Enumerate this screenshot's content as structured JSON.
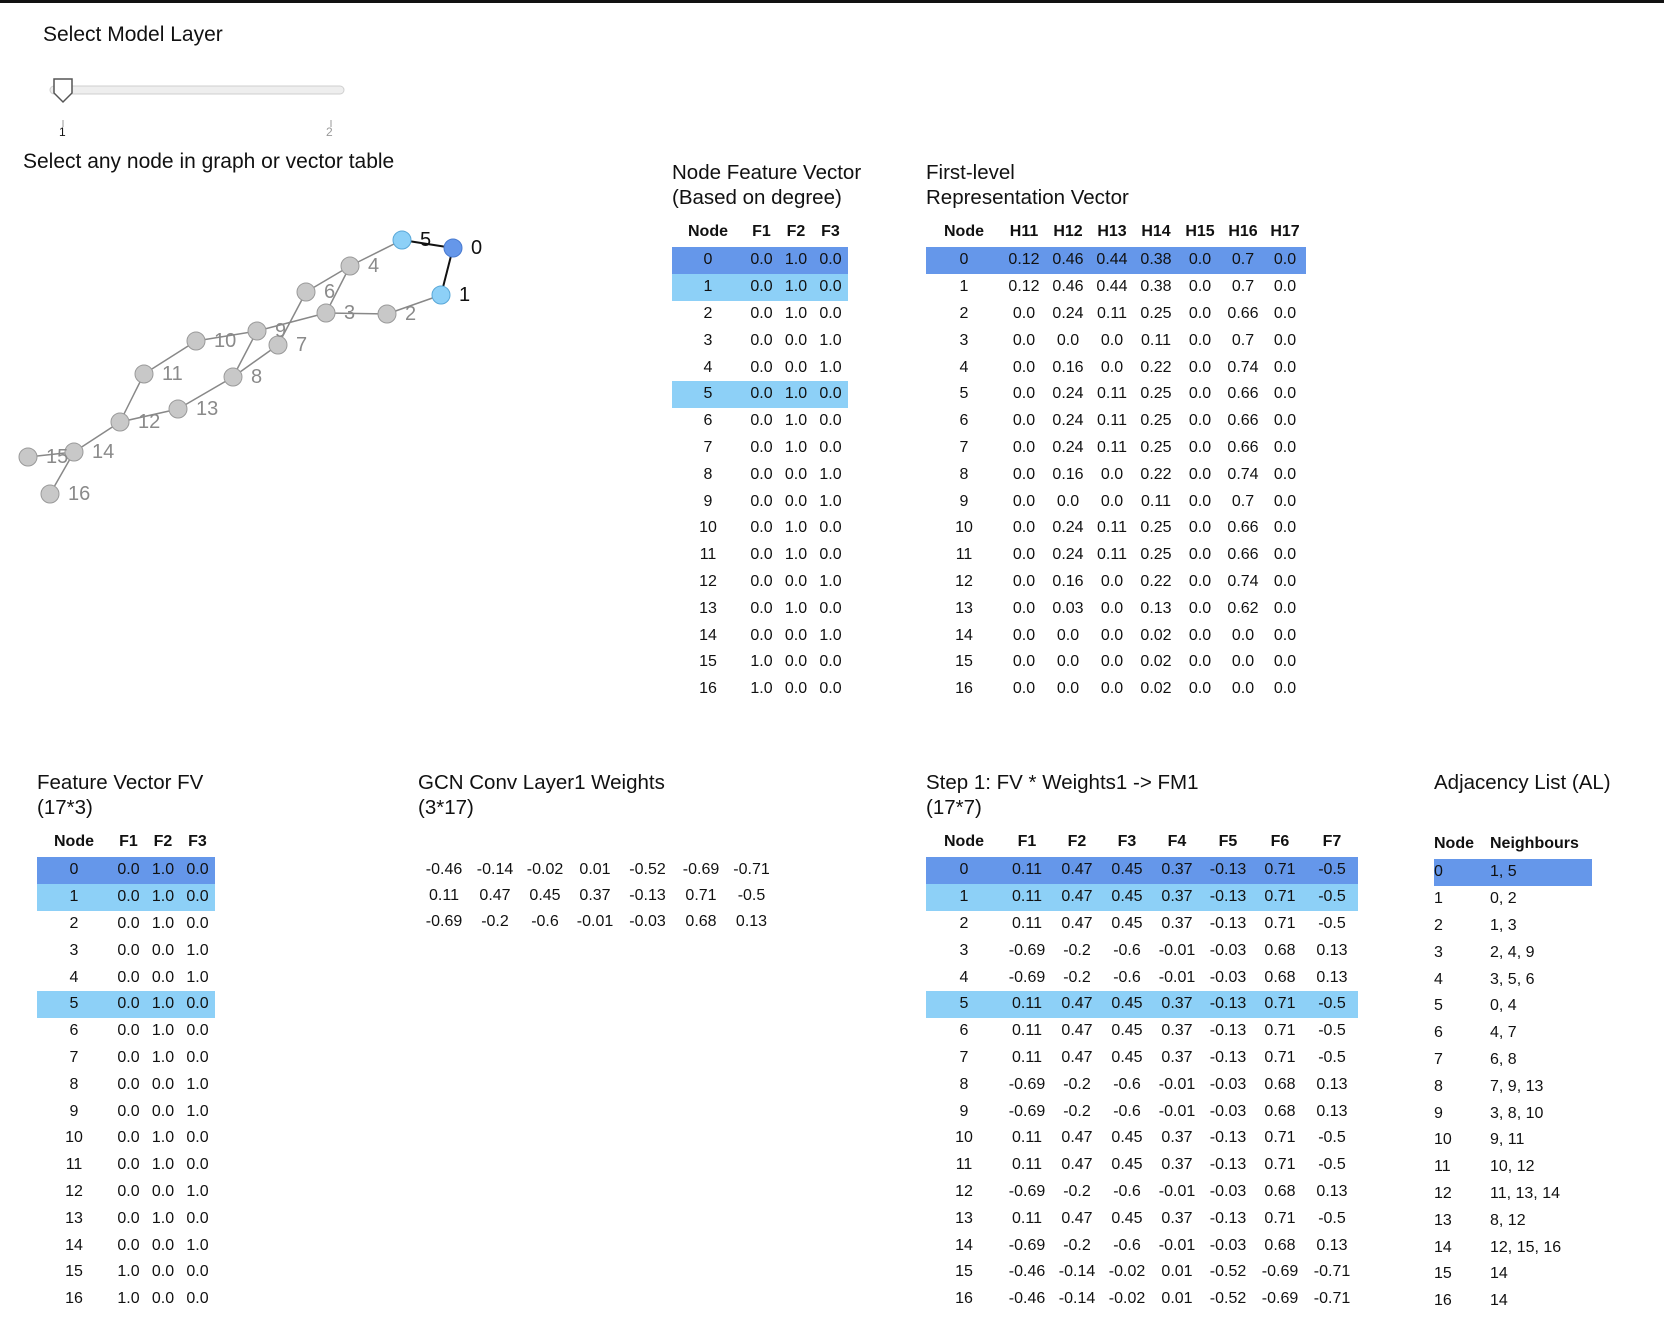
{
  "slider": {
    "label": "Select Model Layer",
    "min_label": "1",
    "max_label": "2",
    "value": 1,
    "min": 1,
    "max": 2
  },
  "instruction": "Select any node in graph or vector table",
  "selected_node": "0",
  "neighbour_nodes": [
    "1",
    "5"
  ],
  "colors": {
    "selected": "#6597ea",
    "neighbour": "#8dd0f7",
    "node_default": "#c8c8c8",
    "node_stroke": "#9a9a9a",
    "edge": "#888888"
  },
  "graph": {
    "nodes": [
      "0",
      "1",
      "2",
      "3",
      "4",
      "5",
      "6",
      "7",
      "8",
      "9",
      "10",
      "11",
      "12",
      "13",
      "14",
      "15",
      "16"
    ],
    "edges": [
      [
        "0",
        "1"
      ],
      [
        "0",
        "5"
      ],
      [
        "1",
        "2"
      ],
      [
        "2",
        "3"
      ],
      [
        "3",
        "4"
      ],
      [
        "3",
        "9"
      ],
      [
        "4",
        "5"
      ],
      [
        "4",
        "6"
      ],
      [
        "6",
        "7"
      ],
      [
        "7",
        "8"
      ],
      [
        "8",
        "9"
      ],
      [
        "8",
        "13"
      ],
      [
        "9",
        "10"
      ],
      [
        "10",
        "11"
      ],
      [
        "11",
        "12"
      ],
      [
        "12",
        "13"
      ],
      [
        "12",
        "14"
      ],
      [
        "14",
        "15"
      ],
      [
        "14",
        "16"
      ]
    ]
  },
  "node_feature": {
    "title_line1": "Node Feature Vector",
    "title_line2": "(Based on degree)",
    "headers": [
      "Node",
      "F1",
      "F2",
      "F3"
    ],
    "rows": [
      [
        "0",
        "0.0",
        "1.0",
        "0.0"
      ],
      [
        "1",
        "0.0",
        "1.0",
        "0.0"
      ],
      [
        "2",
        "0.0",
        "1.0",
        "0.0"
      ],
      [
        "3",
        "0.0",
        "0.0",
        "1.0"
      ],
      [
        "4",
        "0.0",
        "0.0",
        "1.0"
      ],
      [
        "5",
        "0.0",
        "1.0",
        "0.0"
      ],
      [
        "6",
        "0.0",
        "1.0",
        "0.0"
      ],
      [
        "7",
        "0.0",
        "1.0",
        "0.0"
      ],
      [
        "8",
        "0.0",
        "0.0",
        "1.0"
      ],
      [
        "9",
        "0.0",
        "0.0",
        "1.0"
      ],
      [
        "10",
        "0.0",
        "1.0",
        "0.0"
      ],
      [
        "11",
        "0.0",
        "1.0",
        "0.0"
      ],
      [
        "12",
        "0.0",
        "0.0",
        "1.0"
      ],
      [
        "13",
        "0.0",
        "1.0",
        "0.0"
      ],
      [
        "14",
        "0.0",
        "0.0",
        "1.0"
      ],
      [
        "15",
        "1.0",
        "0.0",
        "0.0"
      ],
      [
        "16",
        "1.0",
        "0.0",
        "0.0"
      ]
    ]
  },
  "first_level": {
    "title_line1": "First-level",
    "title_line2": "Representation Vector",
    "headers": [
      "Node",
      "H11",
      "H12",
      "H13",
      "H14",
      "H15",
      "H16",
      "H17"
    ],
    "rows": [
      [
        "0",
        "0.12",
        "0.46",
        "0.44",
        "0.38",
        "0.0",
        "0.7",
        "0.0"
      ],
      [
        "1",
        "0.12",
        "0.46",
        "0.44",
        "0.38",
        "0.0",
        "0.7",
        "0.0"
      ],
      [
        "2",
        "0.0",
        "0.24",
        "0.11",
        "0.25",
        "0.0",
        "0.66",
        "0.0"
      ],
      [
        "3",
        "0.0",
        "0.0",
        "0.0",
        "0.11",
        "0.0",
        "0.7",
        "0.0"
      ],
      [
        "4",
        "0.0",
        "0.16",
        "0.0",
        "0.22",
        "0.0",
        "0.74",
        "0.0"
      ],
      [
        "5",
        "0.0",
        "0.24",
        "0.11",
        "0.25",
        "0.0",
        "0.66",
        "0.0"
      ],
      [
        "6",
        "0.0",
        "0.24",
        "0.11",
        "0.25",
        "0.0",
        "0.66",
        "0.0"
      ],
      [
        "7",
        "0.0",
        "0.24",
        "0.11",
        "0.25",
        "0.0",
        "0.66",
        "0.0"
      ],
      [
        "8",
        "0.0",
        "0.16",
        "0.0",
        "0.22",
        "0.0",
        "0.74",
        "0.0"
      ],
      [
        "9",
        "0.0",
        "0.0",
        "0.0",
        "0.11",
        "0.0",
        "0.7",
        "0.0"
      ],
      [
        "10",
        "0.0",
        "0.24",
        "0.11",
        "0.25",
        "0.0",
        "0.66",
        "0.0"
      ],
      [
        "11",
        "0.0",
        "0.24",
        "0.11",
        "0.25",
        "0.0",
        "0.66",
        "0.0"
      ],
      [
        "12",
        "0.0",
        "0.16",
        "0.0",
        "0.22",
        "0.0",
        "0.74",
        "0.0"
      ],
      [
        "13",
        "0.0",
        "0.03",
        "0.0",
        "0.13",
        "0.0",
        "0.62",
        "0.0"
      ],
      [
        "14",
        "0.0",
        "0.0",
        "0.0",
        "0.02",
        "0.0",
        "0.0",
        "0.0"
      ],
      [
        "15",
        "0.0",
        "0.0",
        "0.0",
        "0.02",
        "0.0",
        "0.0",
        "0.0"
      ],
      [
        "16",
        "0.0",
        "0.0",
        "0.0",
        "0.02",
        "0.0",
        "0.0",
        "0.0"
      ]
    ]
  },
  "feature_fv": {
    "title_line1": "Feature Vector FV",
    "title_line2": "(17*3)",
    "headers": [
      "Node",
      "F1",
      "F2",
      "F3"
    ],
    "rows": [
      [
        "0",
        "0.0",
        "1.0",
        "0.0"
      ],
      [
        "1",
        "0.0",
        "1.0",
        "0.0"
      ],
      [
        "2",
        "0.0",
        "1.0",
        "0.0"
      ],
      [
        "3",
        "0.0",
        "0.0",
        "1.0"
      ],
      [
        "4",
        "0.0",
        "0.0",
        "1.0"
      ],
      [
        "5",
        "0.0",
        "1.0",
        "0.0"
      ],
      [
        "6",
        "0.0",
        "1.0",
        "0.0"
      ],
      [
        "7",
        "0.0",
        "1.0",
        "0.0"
      ],
      [
        "8",
        "0.0",
        "0.0",
        "1.0"
      ],
      [
        "9",
        "0.0",
        "0.0",
        "1.0"
      ],
      [
        "10",
        "0.0",
        "1.0",
        "0.0"
      ],
      [
        "11",
        "0.0",
        "1.0",
        "0.0"
      ],
      [
        "12",
        "0.0",
        "0.0",
        "1.0"
      ],
      [
        "13",
        "0.0",
        "1.0",
        "0.0"
      ],
      [
        "14",
        "0.0",
        "0.0",
        "1.0"
      ],
      [
        "15",
        "1.0",
        "0.0",
        "0.0"
      ],
      [
        "16",
        "1.0",
        "0.0",
        "0.0"
      ]
    ]
  },
  "weights": {
    "title_line1": "GCN Conv Layer1 Weights",
    "title_line2": "(3*17)",
    "rows": [
      [
        "-0.46",
        "-0.14",
        "-0.02",
        "0.01",
        "-0.52",
        "-0.69",
        "-0.71"
      ],
      [
        "0.11",
        "0.47",
        "0.45",
        "0.37",
        "-0.13",
        "0.71",
        "-0.5"
      ],
      [
        "-0.69",
        "-0.2",
        "-0.6",
        "-0.01",
        "-0.03",
        "0.68",
        "0.13"
      ]
    ]
  },
  "step1": {
    "title_line1": "Step 1: FV * Weights1 -> FM1",
    "title_line2": "(17*7)",
    "headers": [
      "Node",
      "F1",
      "F2",
      "F3",
      "F4",
      "F5",
      "F6",
      "F7"
    ],
    "rows": [
      [
        "0",
        "0.11",
        "0.47",
        "0.45",
        "0.37",
        "-0.13",
        "0.71",
        "-0.5"
      ],
      [
        "1",
        "0.11",
        "0.47",
        "0.45",
        "0.37",
        "-0.13",
        "0.71",
        "-0.5"
      ],
      [
        "2",
        "0.11",
        "0.47",
        "0.45",
        "0.37",
        "-0.13",
        "0.71",
        "-0.5"
      ],
      [
        "3",
        "-0.69",
        "-0.2",
        "-0.6",
        "-0.01",
        "-0.03",
        "0.68",
        "0.13"
      ],
      [
        "4",
        "-0.69",
        "-0.2",
        "-0.6",
        "-0.01",
        "-0.03",
        "0.68",
        "0.13"
      ],
      [
        "5",
        "0.11",
        "0.47",
        "0.45",
        "0.37",
        "-0.13",
        "0.71",
        "-0.5"
      ],
      [
        "6",
        "0.11",
        "0.47",
        "0.45",
        "0.37",
        "-0.13",
        "0.71",
        "-0.5"
      ],
      [
        "7",
        "0.11",
        "0.47",
        "0.45",
        "0.37",
        "-0.13",
        "0.71",
        "-0.5"
      ],
      [
        "8",
        "-0.69",
        "-0.2",
        "-0.6",
        "-0.01",
        "-0.03",
        "0.68",
        "0.13"
      ],
      [
        "9",
        "-0.69",
        "-0.2",
        "-0.6",
        "-0.01",
        "-0.03",
        "0.68",
        "0.13"
      ],
      [
        "10",
        "0.11",
        "0.47",
        "0.45",
        "0.37",
        "-0.13",
        "0.71",
        "-0.5"
      ],
      [
        "11",
        "0.11",
        "0.47",
        "0.45",
        "0.37",
        "-0.13",
        "0.71",
        "-0.5"
      ],
      [
        "12",
        "-0.69",
        "-0.2",
        "-0.6",
        "-0.01",
        "-0.03",
        "0.68",
        "0.13"
      ],
      [
        "13",
        "0.11",
        "0.47",
        "0.45",
        "0.37",
        "-0.13",
        "0.71",
        "-0.5"
      ],
      [
        "14",
        "-0.69",
        "-0.2",
        "-0.6",
        "-0.01",
        "-0.03",
        "0.68",
        "0.13"
      ],
      [
        "15",
        "-0.46",
        "-0.14",
        "-0.02",
        "0.01",
        "-0.52",
        "-0.69",
        "-0.71"
      ],
      [
        "16",
        "-0.46",
        "-0.14",
        "-0.02",
        "0.01",
        "-0.52",
        "-0.69",
        "-0.71"
      ]
    ]
  },
  "adjacency": {
    "title": "Adjacency List (AL)",
    "headers": [
      "Node",
      "Neighbours"
    ],
    "rows": [
      [
        "0",
        "1, 5"
      ],
      [
        "1",
        "0, 2"
      ],
      [
        "2",
        "1, 3"
      ],
      [
        "3",
        "2, 4, 9"
      ],
      [
        "4",
        "3, 5, 6"
      ],
      [
        "5",
        "0, 4"
      ],
      [
        "6",
        "4, 7"
      ],
      [
        "7",
        "6, 8"
      ],
      [
        "8",
        "7, 9, 13"
      ],
      [
        "9",
        "3, 8, 10"
      ],
      [
        "10",
        "9, 11"
      ],
      [
        "11",
        "10, 12"
      ],
      [
        "12",
        "11, 13, 14"
      ],
      [
        "13",
        "8, 12"
      ],
      [
        "14",
        "12, 15, 16"
      ],
      [
        "15",
        "14"
      ],
      [
        "16",
        "14"
      ]
    ]
  }
}
